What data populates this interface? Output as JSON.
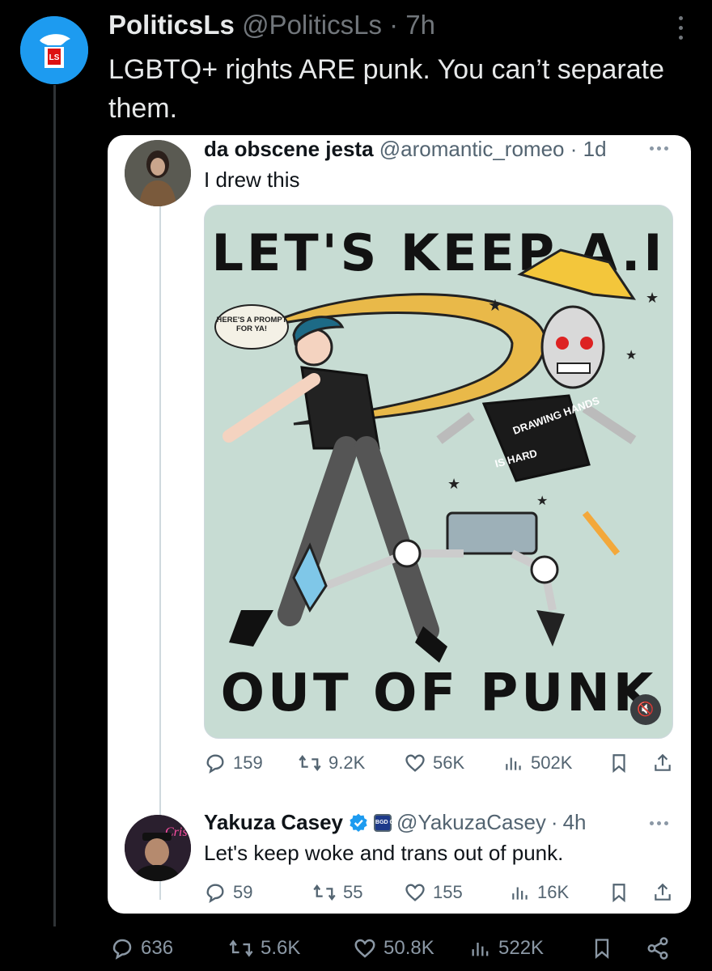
{
  "main_tweet": {
    "display_name": "PoliticsLs",
    "handle": "@PoliticsLs",
    "separator": "·",
    "time": "7h",
    "text": "LGBTQ+ rights ARE punk. You can’t separate them.",
    "avatar_icon": "politicsls-logo-icon",
    "avatar_text": "LS",
    "stats": {
      "replies": "636",
      "retweets": "5.6K",
      "likes": "50.8K",
      "views": "522K"
    }
  },
  "quoted_tweet": {
    "display_name": "da obscene jesta",
    "handle": "@aromantic_romeo",
    "separator": "·",
    "time": "1d",
    "text": "I drew this",
    "image": {
      "title_top": "LET'S KEEP A.I",
      "title_bottom": "OUT OF PUNK",
      "speech_bubble": "HERE'S A PROMPT FOR YA!",
      "shirt_text_top": "DRAWING HANDS",
      "shirt_text_bottom": "IS HARD",
      "mute_icon": "mute-icon"
    },
    "stats": {
      "replies": "159",
      "retweets": "9.2K",
      "likes": "56K",
      "views": "502K"
    }
  },
  "reply_tweet": {
    "display_name": "Yakuza Casey",
    "handle": "@YakuzaCasey",
    "separator": "·",
    "time": "4h",
    "affiliate_badge": "BGD CLB",
    "text": "Let's keep woke and trans out of punk.",
    "stats": {
      "replies": "59",
      "retweets": "55",
      "likes": "155",
      "views": "16K"
    }
  },
  "colors": {
    "background": "#000000",
    "card": "#ffffff",
    "accent": "#1d9bf0",
    "muted": "#71767b"
  }
}
